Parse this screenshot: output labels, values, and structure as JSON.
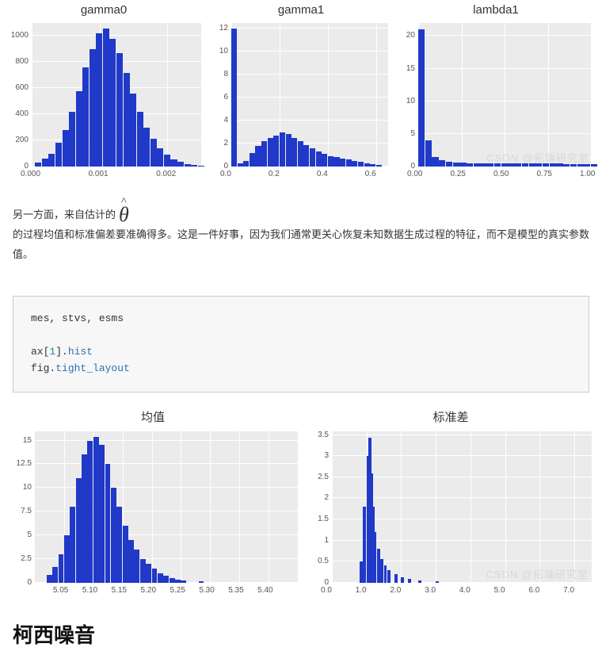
{
  "row1_titles": [
    "gamma0",
    "gamma1",
    "lambda1"
  ],
  "paragraph": {
    "p1": "另一方面，来自估计的",
    "p2": "的过程均值和标准偏差要准确得多。这是一件好事，因为我们通常更关心恢复未知数据生成过程的特征，而不是模型的真实参数值。"
  },
  "code": {
    "l1": "mes, stvs, esms",
    "l2a": "ax",
    "l2b": "[",
    "l2c": "1",
    "l2d": "].",
    "l2e": "hist",
    "l3a": "fig.",
    "l3b": "tight_layout"
  },
  "row2_titles": [
    "均值",
    "标准差"
  ],
  "section_heading": "柯西噪音",
  "watermark": "CSDN @拓端研究室",
  "chart_data": [
    {
      "type": "histogram",
      "title": "gamma0",
      "xlabel": "",
      "ylabel": "",
      "xlim": [
        0.0,
        0.0025
      ],
      "ylim": [
        0,
        1100
      ],
      "xticks": [
        0.0,
        0.001,
        0.002
      ],
      "yticks": [
        0,
        200,
        400,
        600,
        800,
        1000
      ],
      "x": [
        5e-05,
        0.00015,
        0.00025,
        0.00035,
        0.00045,
        0.00055,
        0.00065,
        0.00075,
        0.00085,
        0.00095,
        0.00105,
        0.00115,
        0.00125,
        0.00135,
        0.00145,
        0.00155,
        0.00165,
        0.00175,
        0.00185,
        0.00195,
        0.00205,
        0.00215,
        0.00225,
        0.00235,
        0.00245
      ],
      "counts": [
        30,
        60,
        100,
        180,
        280,
        420,
        580,
        760,
        900,
        1020,
        1060,
        980,
        870,
        720,
        560,
        420,
        300,
        210,
        140,
        90,
        55,
        35,
        20,
        10,
        5
      ]
    },
    {
      "type": "histogram",
      "title": "gamma1",
      "xlim": [
        0.0,
        0.65
      ],
      "ylim": [
        0,
        12.5
      ],
      "xticks": [
        0.0,
        0.2,
        0.4,
        0.6
      ],
      "yticks": [
        0,
        2,
        4,
        6,
        8,
        10,
        12
      ],
      "x": [
        0.0,
        0.025,
        0.05,
        0.075,
        0.1,
        0.125,
        0.15,
        0.175,
        0.2,
        0.225,
        0.25,
        0.275,
        0.3,
        0.325,
        0.35,
        0.375,
        0.4,
        0.425,
        0.45,
        0.475,
        0.5,
        0.525,
        0.55,
        0.575,
        0.6
      ],
      "counts": [
        12,
        0.3,
        0.5,
        1.2,
        1.8,
        2.2,
        2.5,
        2.7,
        3.0,
        2.8,
        2.5,
        2.2,
        1.9,
        1.6,
        1.3,
        1.1,
        0.9,
        0.8,
        0.7,
        0.6,
        0.5,
        0.4,
        0.3,
        0.2,
        0.15
      ]
    },
    {
      "type": "histogram",
      "title": "lambda1",
      "xlim": [
        0.0,
        1.0
      ],
      "ylim": [
        0,
        22
      ],
      "xticks": [
        0.0,
        0.25,
        0.5,
        0.75,
        1.0
      ],
      "yticks": [
        0,
        5,
        10,
        15,
        20
      ],
      "x": [
        0.0,
        0.04,
        0.08,
        0.12,
        0.16,
        0.2,
        0.24,
        0.28,
        0.32,
        0.36,
        0.4,
        0.44,
        0.48,
        0.52,
        0.56,
        0.6,
        0.64,
        0.68,
        0.72,
        0.76,
        0.8,
        0.84,
        0.88,
        0.92,
        0.96,
        1.0
      ],
      "counts": [
        21,
        4,
        1.5,
        1.0,
        0.7,
        0.6,
        0.55,
        0.5,
        0.5,
        0.5,
        0.5,
        0.5,
        0.5,
        0.5,
        0.5,
        0.5,
        0.5,
        0.5,
        0.5,
        0.5,
        0.5,
        0.4,
        0.4,
        0.4,
        0.4,
        0.4
      ]
    },
    {
      "type": "histogram",
      "title": "均值",
      "xlim": [
        5.0,
        5.45
      ],
      "ylim": [
        0,
        16
      ],
      "xticks": [
        5.05,
        5.1,
        5.15,
        5.2,
        5.25,
        5.3,
        5.35,
        5.4
      ],
      "yticks": [
        0.0,
        2.5,
        5.0,
        7.5,
        10.0,
        12.5,
        15.0
      ],
      "x": [
        5.02,
        5.03,
        5.04,
        5.05,
        5.06,
        5.07,
        5.08,
        5.09,
        5.1,
        5.11,
        5.12,
        5.13,
        5.14,
        5.15,
        5.16,
        5.17,
        5.18,
        5.19,
        5.2,
        5.21,
        5.22,
        5.23,
        5.24,
        5.25,
        5.28
      ],
      "counts": [
        0.8,
        1.6,
        3.0,
        5.0,
        8.0,
        11.0,
        13.5,
        15.0,
        15.4,
        14.5,
        12.5,
        10.0,
        8.0,
        6.0,
        4.5,
        3.5,
        2.5,
        2.0,
        1.5,
        1.0,
        0.7,
        0.5,
        0.3,
        0.2,
        0.1
      ]
    },
    {
      "type": "histogram",
      "title": "标准差",
      "xlim": [
        0,
        7.5
      ],
      "ylim": [
        0,
        3.6
      ],
      "xticks": [
        0,
        1,
        2,
        3,
        4,
        5,
        6,
        7
      ],
      "yticks": [
        0.0,
        0.5,
        1.0,
        1.5,
        2.0,
        2.5,
        3.0,
        3.5
      ],
      "x": [
        0.8,
        0.9,
        1.0,
        1.05,
        1.1,
        1.15,
        1.2,
        1.3,
        1.4,
        1.5,
        1.6,
        1.8,
        2.0,
        2.2,
        2.5,
        3.0
      ],
      "counts": [
        0.5,
        1.8,
        3.0,
        3.45,
        2.6,
        1.8,
        1.2,
        0.8,
        0.55,
        0.4,
        0.3,
        0.2,
        0.12,
        0.08,
        0.05,
        0.03
      ]
    }
  ]
}
